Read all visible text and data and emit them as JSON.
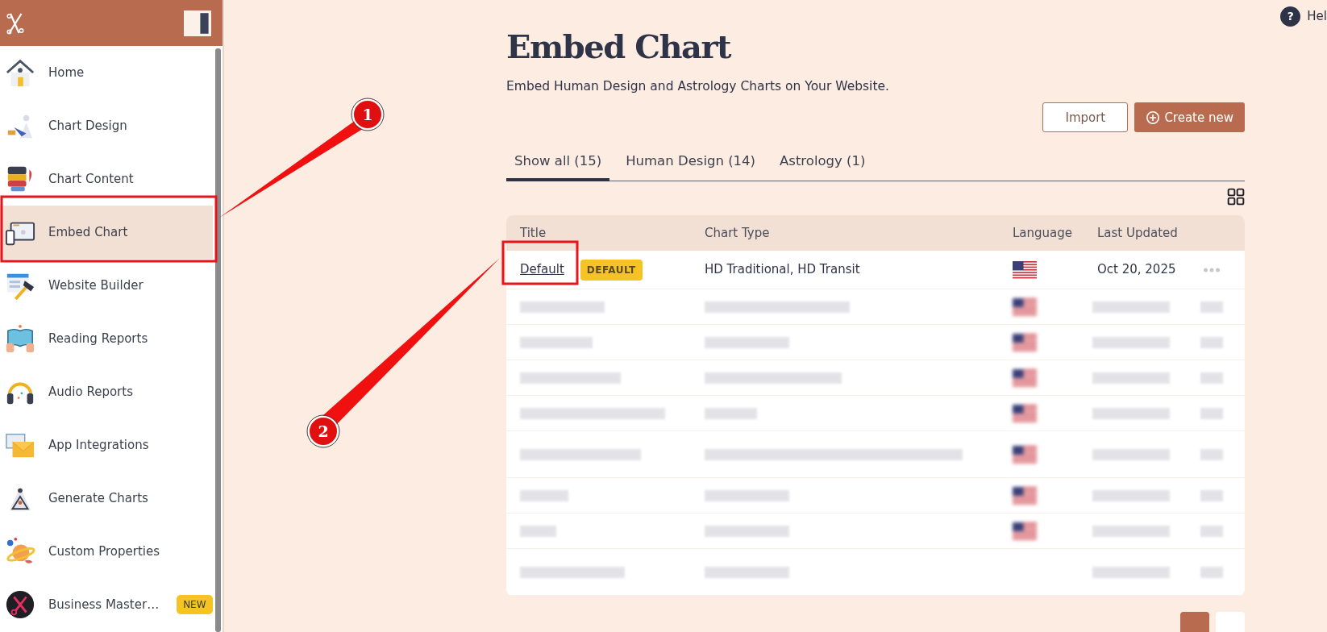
{
  "sidebar": {
    "items": [
      {
        "label": "Home",
        "selected": false
      },
      {
        "label": "Chart Design",
        "selected": false
      },
      {
        "label": "Chart Content",
        "selected": false
      },
      {
        "label": "Embed Chart",
        "selected": true
      },
      {
        "label": "Website Builder",
        "selected": false
      },
      {
        "label": "Reading Reports",
        "selected": false
      },
      {
        "label": "Audio Reports",
        "selected": false
      },
      {
        "label": "App Integrations",
        "selected": false
      },
      {
        "label": "Generate Charts",
        "selected": false
      },
      {
        "label": "Custom Properties",
        "selected": false
      },
      {
        "label": "Business Master…",
        "selected": false,
        "badge": "NEW"
      }
    ]
  },
  "help": {
    "icon": "?",
    "label": "Hel"
  },
  "page": {
    "title": "Embed Chart",
    "subtitle": "Embed Human Design and Astrology Charts on Your Website."
  },
  "buttons": [
    {
      "kind": "outline",
      "label": "Import"
    },
    {
      "kind": "primary",
      "label": "Create new"
    }
  ],
  "tabs": [
    {
      "label": "Show all (15)",
      "selected": true
    },
    {
      "label": "Human Design (14)",
      "selected": false
    },
    {
      "label": "Astrology (1)",
      "selected": false
    }
  ],
  "table": {
    "columns": [
      "Title",
      "Chart Type",
      "Language",
      "Last Updated"
    ],
    "rows": [
      {
        "kind": "plain",
        "title": "Default",
        "badge": "DEFAULT",
        "chart_type": "HD Traditional, HD Transit",
        "flag": true,
        "updated": "Oct 20, 2025"
      },
      {
        "kind": "redacted",
        "flag": true,
        "tall": false
      },
      {
        "kind": "redacted",
        "flag": true,
        "tall": false
      },
      {
        "kind": "redacted",
        "flag": true,
        "tall": false
      },
      {
        "kind": "redacted",
        "flag": true,
        "tall": false
      },
      {
        "kind": "redacted",
        "flag": true,
        "tall": true
      },
      {
        "kind": "redacted",
        "flag": true,
        "tall": false
      },
      {
        "kind": "redacted",
        "flag": true,
        "tall": false
      },
      {
        "kind": "redacted",
        "flag": false,
        "tall": true
      }
    ]
  },
  "pagination": [
    {
      "selected": true
    },
    {
      "selected": false
    }
  ],
  "annotations": [
    {
      "label": "1"
    },
    {
      "label": "2"
    }
  ]
}
